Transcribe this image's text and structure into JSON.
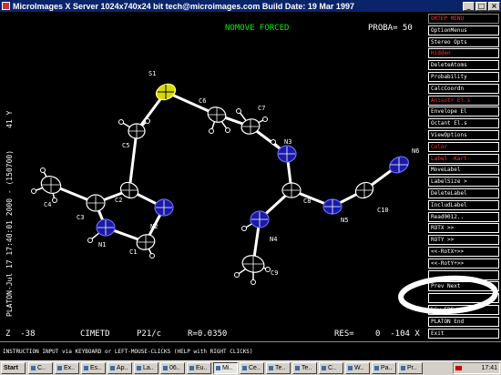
{
  "window": {
    "title": "MicroImages X Server  1024x740x24 bit  tech@microimages.com  Build Date: 19 Mar 1997"
  },
  "hud": {
    "mode": "NOMOVE FORCED",
    "proba": "PROBA= 50",
    "side_label": "PLATON-Jul 17 17:40:01 2000 - (150700)",
    "side_value": "41 Y",
    "z": "Z  -38",
    "code": "CIMETD",
    "spacegroup": "P21/c",
    "r": "R=0.0350",
    "res": "RES=",
    "angles": "0  -104 X"
  },
  "status": "INSTRUCTION INPUT via KEYBOARD or LEFT-MOUSE-CLICKS (HELP with RIGHT CLICKS)",
  "menu": [
    {
      "label": "ORTEP MENU",
      "style": "hdr"
    },
    {
      "label": "OptionMenus"
    },
    {
      "label": "Stereo Opts"
    },
    {
      "label": "Hidden",
      "style": "red"
    },
    {
      "label": "DeleteAtoms"
    },
    {
      "label": "Probability"
    },
    {
      "label": "CalcCoordn"
    },
    {
      "label": "Anisotr El.s",
      "style": "red"
    },
    {
      "label": "Envelope El"
    },
    {
      "label": "Octant El.s"
    },
    {
      "label": "ViewOptions"
    },
    {
      "label": "Color",
      "style": "red"
    },
    {
      "label": "Label -Kart-",
      "style": "red"
    },
    {
      "label": "MoveLabel"
    },
    {
      "label": "LabelSize >"
    },
    {
      "label": "DeleteLabel"
    },
    {
      "label": "IncludLabel"
    },
    {
      "label": "Read0012.."
    },
    {
      "label": "ROTX >>"
    },
    {
      "label": "ROTY >>"
    },
    {
      "label": "<<-RotX+>>"
    },
    {
      "label": "<<-RotY+>>"
    },
    {
      "label": ""
    },
    {
      "label": "Prev    Next"
    },
    {
      "label": ""
    },
    {
      "label": "b6w-EPS-col"
    },
    {
      "label": "PLATON    End"
    },
    {
      "label": "Exit"
    }
  ],
  "atoms": [
    "S1",
    "C6",
    "C7",
    "N3",
    "N6",
    "C5",
    "C4",
    "C2",
    "C3",
    "N2",
    "N1",
    "C1",
    "C8",
    "C10",
    "N5",
    "N4",
    "C9"
  ],
  "taskbar": {
    "start": "Start",
    "tasks": [
      "C..",
      "Ex..",
      "Es..",
      "Ap..",
      "La..",
      "06..",
      "Eu..",
      "Mi..",
      "Ce..",
      "Te..",
      "Te..",
      "C..",
      "W..",
      "Pa..",
      "Pr.."
    ],
    "clock": "17:41"
  },
  "colors": {
    "title_bg": "#0a246a",
    "sulfur": "#d9d900",
    "nitrogen": "#1a1aa6",
    "carbon": "#ffffff",
    "hud_green": "#00ee00"
  }
}
